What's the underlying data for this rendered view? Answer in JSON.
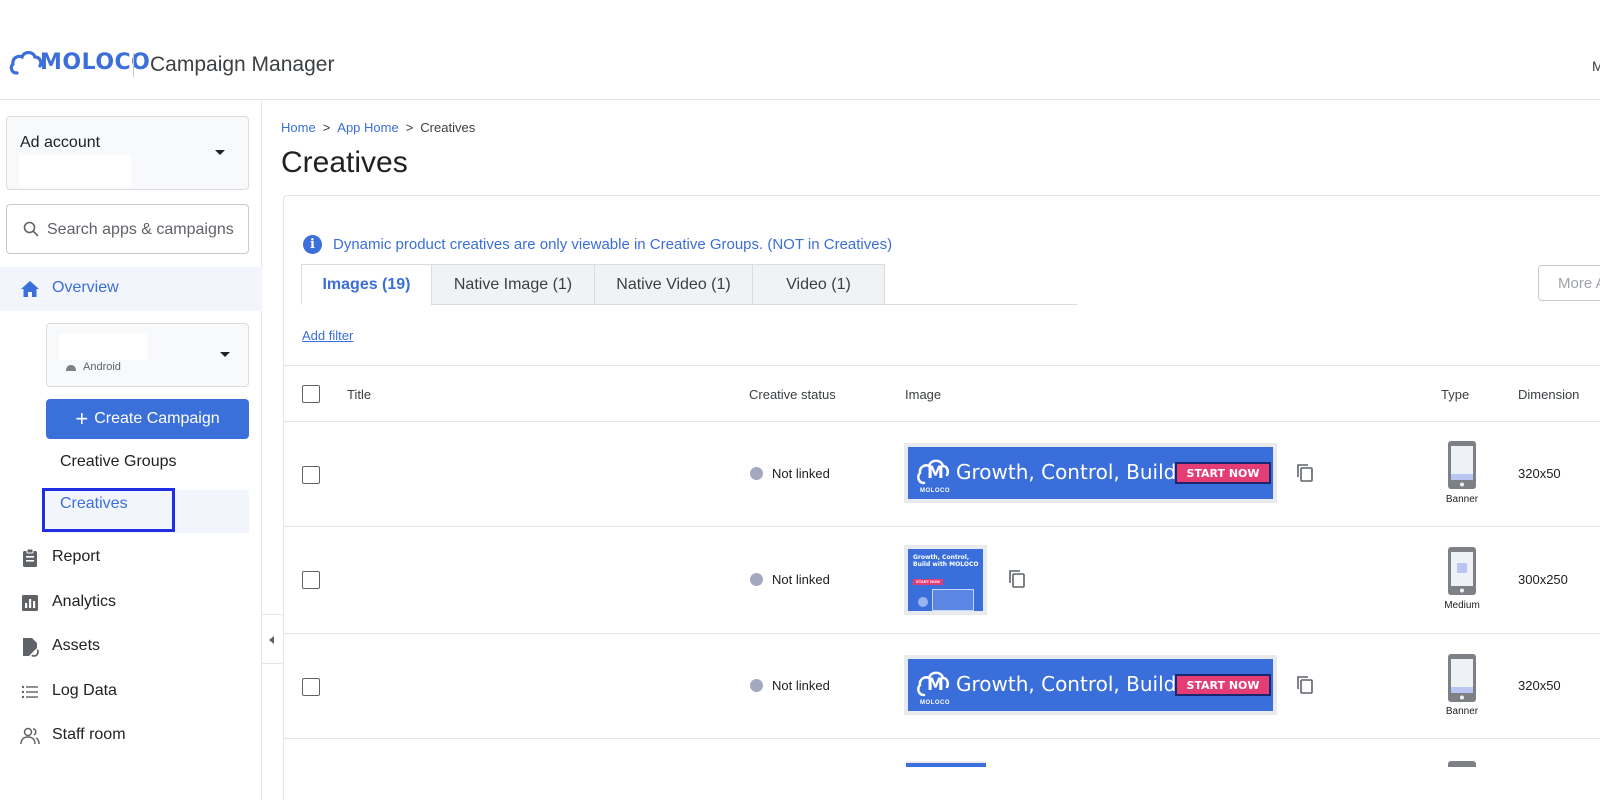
{
  "header": {
    "brand_text": "MOLOCO",
    "app_title": "Campaign Manager",
    "right_initial": "M"
  },
  "sidebar": {
    "ad_account_label": "Ad account",
    "search_placeholder": "Search apps & campaigns",
    "overview_label": "Overview",
    "app_platform": "Android",
    "create_campaign_label": "Create Campaign",
    "sub_items": [
      "Creative Groups",
      "Creatives"
    ],
    "nav_items": [
      "Report",
      "Analytics",
      "Assets",
      "Log Data",
      "Staff room"
    ]
  },
  "main": {
    "breadcrumb": [
      "Home",
      "App Home",
      "Creatives"
    ],
    "breadcrumb_sep": ">",
    "page_title": "Creatives",
    "info_message": "Dynamic product creatives are only viewable in Creative Groups. (NOT in Creatives)",
    "tabs": [
      {
        "label": "Images (19)",
        "active": true
      },
      {
        "label": "Native Image (1)",
        "active": false
      },
      {
        "label": "Native Video (1)",
        "active": false
      },
      {
        "label": "Video (1)",
        "active": false
      }
    ],
    "more_button_label": "More A",
    "add_filter_label": "Add filter",
    "table": {
      "columns": [
        "Title",
        "Creative status",
        "Image",
        "Type",
        "Dimension"
      ],
      "rows": [
        {
          "status": "Not linked",
          "type": "Banner",
          "dimension": "320x50"
        },
        {
          "status": "Not linked",
          "type": "Medium",
          "dimension": "300x250"
        },
        {
          "status": "Not linked",
          "type": "Banner",
          "dimension": "320x50"
        }
      ]
    },
    "creative": {
      "logo_letter": "M",
      "logo_brand": "MOLOCO",
      "headline": "Growth, Control, Build",
      "cta": "START NOW",
      "medium_headline": "Growth, Control, Build with MOLOCO",
      "medium_cta": "START NOW"
    }
  },
  "colors": {
    "accent": "#3b6fd9",
    "active_outline": "#1f2fe0",
    "status_dot": "#a3a8bf",
    "cta_pink": "#e43d74"
  },
  "icons": {
    "logo": "moloco-cloud-logo",
    "search": "search-icon",
    "overview": "home-icon",
    "report": "clipboard-icon",
    "analytics": "bar-chart-icon",
    "assets": "link-file-icon",
    "log_data": "list-icon",
    "staff_room": "people-icon",
    "copy": "copy-icon",
    "device": "phone-icon",
    "info": "info-icon"
  }
}
